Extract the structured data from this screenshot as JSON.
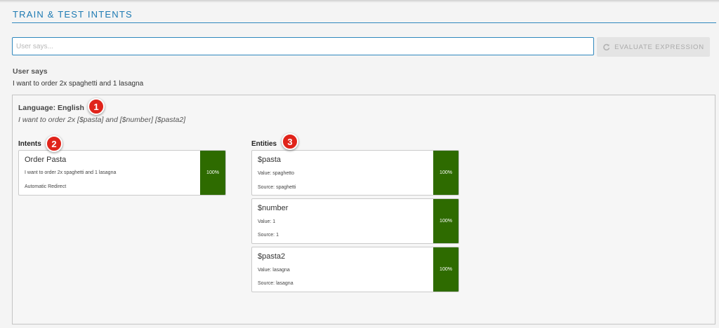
{
  "header": {
    "title": "TRAIN & TEST INTENTS"
  },
  "search": {
    "placeholder": "User says...",
    "value": ""
  },
  "evaluate_button": {
    "label": "EVALUATE EXPRESSION",
    "icon": "refresh-icon"
  },
  "user_says": {
    "heading": "User says",
    "text": "I want to order 2x spaghetti and 1 lasagna"
  },
  "result": {
    "language_line": "Language: English",
    "annotated_expression": "I want to order 2x [$pasta] and [$number] [$pasta2]",
    "intents": {
      "heading": "Intents",
      "items": [
        {
          "title": "Order Pasta",
          "expression": "I want to order 2x spaghetti and 1 lasagna",
          "redirect": "Automatic Redirect",
          "score": "100%"
        }
      ]
    },
    "entities": {
      "heading": "Entities",
      "items": [
        {
          "title": "$pasta",
          "value": "Value: spaghetto",
          "source": "Source: spaghetti",
          "score": "100%"
        },
        {
          "title": "$number",
          "value": "Value: 1",
          "source": "Source: 1",
          "score": "100%"
        },
        {
          "title": "$pasta2",
          "value": "Value: lasagna",
          "source": "Source: lasagna",
          "score": "100%"
        }
      ]
    }
  },
  "annotations": {
    "badge_1": "1",
    "badge_2": "2",
    "badge_3": "3"
  },
  "colors": {
    "accent": "#1d7ab3",
    "score_fill": "#2e6b00",
    "badge": "#e0241b"
  }
}
